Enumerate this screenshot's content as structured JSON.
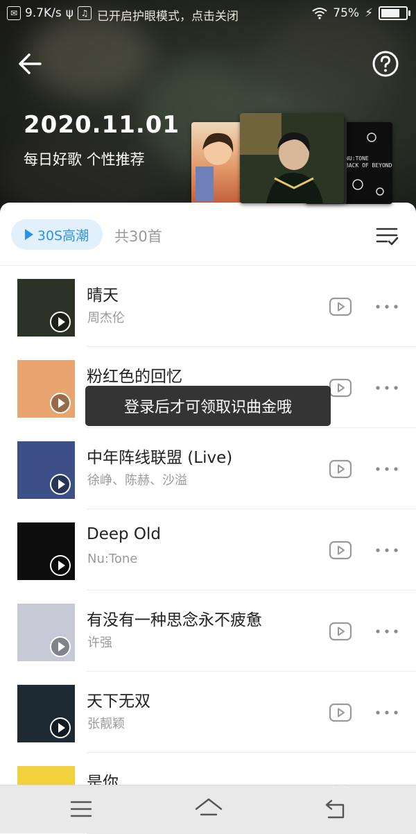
{
  "status_bar": {
    "speed": "9.7K/s",
    "center_text": "已开启护眼模式，点击关闭",
    "battery": "75%",
    "battery_level": 0.75
  },
  "header": {
    "date": "2020.11.01",
    "subtitle": "每日好歌 个性推荐"
  },
  "toolbar": {
    "preview_label": "30S高潮",
    "count_label": "共30首"
  },
  "songs": [
    {
      "title": "晴天",
      "artist": "周杰伦",
      "cover_color": "#2c3326"
    },
    {
      "title": "粉红色的回忆",
      "artist": "",
      "cover_color": "#e9a46f"
    },
    {
      "title": "中年阵线联盟 (Live)",
      "artist": "徐峥、陈赫、沙溢",
      "cover_color": "#3c4f86"
    },
    {
      "title": "Deep Old",
      "artist": "Nu:Tone",
      "cover_color": "#0d0d0d"
    },
    {
      "title": "有没有一种思念永不疲惫",
      "artist": "许强",
      "cover_color": "#c7c9d6"
    },
    {
      "title": "天下无双",
      "artist": "张靓颖",
      "cover_color": "#1d2a33"
    },
    {
      "title": "是你",
      "artist": "",
      "cover_color": "#f2d23c"
    }
  ],
  "toast": {
    "text": "登录后才可领取识曲金哦"
  },
  "album_stack": {
    "stack4_text_1": "NU:TONE",
    "stack4_text_2": "BACK OF BEYOND"
  }
}
